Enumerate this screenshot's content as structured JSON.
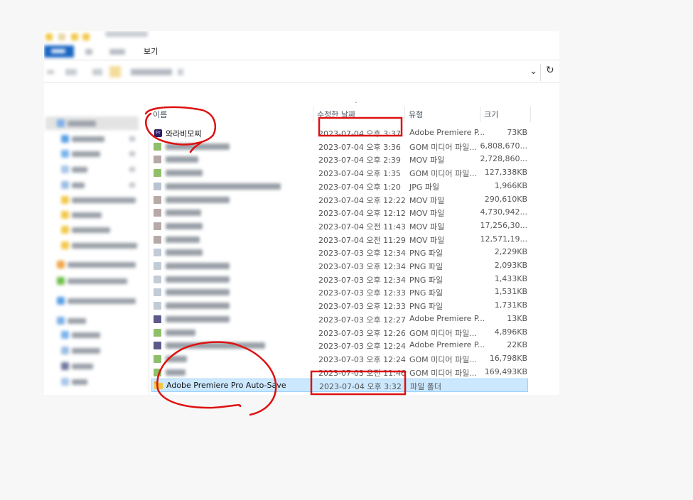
{
  "ribbon": {
    "view_tab": "보기"
  },
  "columns": {
    "name": "이름",
    "modified": "수정한 날짜",
    "type": "유형",
    "size": "크기"
  },
  "files": [
    {
      "name": "와라비모찌",
      "icon": "premiere-pro-icon",
      "icon_color": "#2b1e60",
      "modified": "2023-07-04 오후 3:37",
      "type": "Adobe Premiere P...",
      "size": "73KB",
      "name_visible": true
    },
    {
      "name": "",
      "icon": "gom-video-icon",
      "icon_color": "#8fbf6a",
      "modified": "2023-07-04 오후 3:36",
      "type": "GOM 미디어 파일...",
      "size": "6,808,670...",
      "name_visible": false
    },
    {
      "name": "",
      "icon": "mov-file-icon",
      "icon_color": "#b7a9a8",
      "modified": "2023-07-04 오후 2:39",
      "type": "MOV 파일",
      "size": "2,728,860...",
      "name_visible": false
    },
    {
      "name": "",
      "icon": "gom-video-icon",
      "icon_color": "#8fbf6a",
      "modified": "2023-07-04 오후 1:35",
      "type": "GOM 미디어 파일...",
      "size": "127,338KB",
      "name_visible": false
    },
    {
      "name": "",
      "icon": "image-file-icon",
      "icon_color": "#b8c4d0",
      "modified": "2023-07-04 오후 1:20",
      "type": "JPG 파일",
      "size": "1,966KB",
      "name_visible": false
    },
    {
      "name": "",
      "icon": "mov-file-icon",
      "icon_color": "#b7a9a8",
      "modified": "2023-07-04 오후 12:22",
      "type": "MOV 파일",
      "size": "290,610KB",
      "name_visible": false
    },
    {
      "name": "",
      "icon": "mov-file-icon",
      "icon_color": "#b7a9a8",
      "modified": "2023-07-04 오후 12:12",
      "type": "MOV 파일",
      "size": "4,730,942...",
      "name_visible": false
    },
    {
      "name": "",
      "icon": "mov-file-icon",
      "icon_color": "#b7a9a8",
      "modified": "2023-07-04 오전 11:43",
      "type": "MOV 파일",
      "size": "17,256,30...",
      "name_visible": false
    },
    {
      "name": "",
      "icon": "mov-file-icon",
      "icon_color": "#b7a9a8",
      "modified": "2023-07-04 오전 11:29",
      "type": "MOV 파일",
      "size": "12,571,19...",
      "name_visible": false
    },
    {
      "name": "",
      "icon": "png-file-icon",
      "icon_color": "#c2ccd6",
      "modified": "2023-07-03 오후 12:34",
      "type": "PNG 파일",
      "size": "2,229KB",
      "name_visible": false
    },
    {
      "name": "",
      "icon": "png-file-icon",
      "icon_color": "#c2ccd6",
      "modified": "2023-07-03 오후 12:34",
      "type": "PNG 파일",
      "size": "2,093KB",
      "name_visible": false
    },
    {
      "name": "",
      "icon": "png-file-icon",
      "icon_color": "#c2ccd6",
      "modified": "2023-07-03 오후 12:34",
      "type": "PNG 파일",
      "size": "1,433KB",
      "name_visible": false
    },
    {
      "name": "",
      "icon": "png-file-icon",
      "icon_color": "#c2ccd6",
      "modified": "2023-07-03 오후 12:33",
      "type": "PNG 파일",
      "size": "1,531KB",
      "name_visible": false
    },
    {
      "name": "",
      "icon": "png-file-icon",
      "icon_color": "#c2ccd6",
      "modified": "2023-07-03 오후 12:33",
      "type": "PNG 파일",
      "size": "1,731KB",
      "name_visible": false
    },
    {
      "name": "",
      "icon": "premiere-pro-icon",
      "icon_color": "#5c5a8a",
      "modified": "2023-07-03 오후 12:27",
      "type": "Adobe Premiere P...",
      "size": "13KB",
      "name_visible": false
    },
    {
      "name": "",
      "icon": "gom-video-icon",
      "icon_color": "#8fbf6a",
      "modified": "2023-07-03 오후 12:26",
      "type": "GOM 미디어 파일...",
      "size": "4,896KB",
      "name_visible": false
    },
    {
      "name": "",
      "icon": "premiere-pro-icon",
      "icon_color": "#5c5a8a",
      "modified": "2023-07-03 오후 12:24",
      "type": "Adobe Premiere P...",
      "size": "22KB",
      "name_visible": false
    },
    {
      "name": "",
      "icon": "gom-video-icon",
      "icon_color": "#8fbf6a",
      "modified": "2023-07-03 오후 12:24",
      "type": "GOM 미디어 파일...",
      "size": "16,798KB",
      "name_visible": false
    },
    {
      "name": "",
      "icon": "gom-video-icon",
      "icon_color": "#8fbf6a",
      "modified": "2023-07-03 오전 11:46",
      "type": "GOM 미디어 파일...",
      "size": "169,493KB",
      "name_visible": false
    },
    {
      "name": "Adobe Premiere Pro Auto-Save",
      "icon": "folder-icon",
      "icon_color": "#f5c642",
      "modified": "2023-07-04 오후 3:32",
      "type": "파일 폴더",
      "size": "",
      "name_visible": true,
      "selected": true
    }
  ],
  "annotation_color": "#dd1111"
}
